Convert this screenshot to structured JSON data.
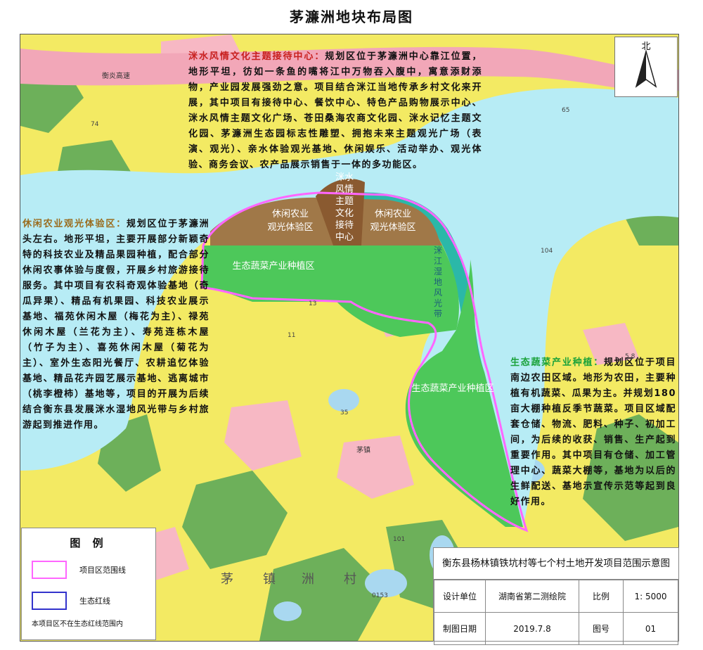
{
  "page_title": "茅濂洲地块布局图",
  "compass_label": "北",
  "map_labels": {
    "road_top": "衡炎高速",
    "zone_leisure_left": "休闲农业\n观光体验区",
    "zone_leisure_right": "休闲农业\n观光体验区",
    "zone_center": "洣水风情主题文化接待中心",
    "zone_veg_north": "生态蔬菜产业种植区",
    "zone_veg_south": "生态蔬菜产业种植区",
    "river_belt": "洣江湿地风光带",
    "town": "茅镇",
    "village_chars": [
      "茅",
      "镇",
      "洲",
      "村"
    ]
  },
  "descriptions": {
    "reception": {
      "heading": "洣水风情文化主题接待中心：",
      "body": "规划区位于茅濂洲中心靠江位置，地形平坦，彷如一条鱼的嘴将江中万物吞入腹中，寓意添财添物，产业园发展强劲之意。项目结合洣江当地传承乡村文化来开展，其中项目有接待中心、餐饮中心、特色产品购物展示中心、洣水风情主题文化广场、苍田桑海农商文化园、洣水记忆主题文化园、茅濂洲生态园标志性雕塑、拥抱未来主题观光广场（表演、观光）、亲水体验观光基地、休闲娱乐、活动举办、观光体验、商务会议、农产品展示销售于一体的多功能区。"
    },
    "leisure": {
      "heading": "休闲农业观光体验区：",
      "body": "规划区位于茅濂洲头左右。地形平坦，主要开展部分新颖奇特的科技农业及精品果园种植，配合部分休闲农事体验与度假，开展乡村旅游接待服务。其中项目有农科奇观体验基地（奇瓜异果）、精品有机果园、科技农业展示基地、福苑休闲木屋（梅花为主）、禄苑休闲木屋（兰花为主）、寿苑连栋木屋（竹子为主）、喜苑休闲木屋（菊花为主）、室外生态阳光餐厅、农耕追忆体验基地、精品花卉园艺展示基地、逃离城市（桃李橙柿）基地等，项目的开展为后续结合衡东县发展洣水湿地风光带与乡村旅游起到推进作用。"
    },
    "vegetable": {
      "heading": "生态蔬菜产业种植：",
      "body": "规划区位于项目南边农田区域。地形为农田，主要种植有机蔬菜、瓜果为主。并规划180亩大棚种植反季节蔬菜。项目区域配套仓储、物流、肥料、种子、初加工间，为后续的收获、销售、生产起到重要作用。其中项目有仓储、加工管理中心、蔬菜大棚等，基地为以后的生鲜配送、基地示宣传示范等起到良好作用。"
    }
  },
  "legend": {
    "title": "图  例",
    "items": [
      {
        "label": "项目区范围线",
        "color": "#ff66ff"
      },
      {
        "label": "生态红线",
        "color": "#3333cc"
      }
    ],
    "note": "本项目区不在生态红线范围内"
  },
  "title_block": {
    "title": "衡东县杨林镇铁坑村等七个村土地开发项目范围示意图",
    "design_unit_label": "设计单位",
    "design_unit": "湖南省第二测绘院",
    "scale_label": "比例",
    "scale": "1: 5000",
    "date_label": "制图日期",
    "date": "2019.7.8",
    "number_label": "图号",
    "number": "01"
  },
  "colors": {
    "river": "#b7ecf5",
    "farmland": "#f3ea63",
    "project_boundary": "#ff66ff",
    "vegetable_zone": "#4dc85a",
    "leisure_zone": "#a07848",
    "reception_zone": "#8a5a30",
    "wetland_belt": "#2bb8a8",
    "village": "#f7b8c4",
    "forest": "#6db05a"
  }
}
